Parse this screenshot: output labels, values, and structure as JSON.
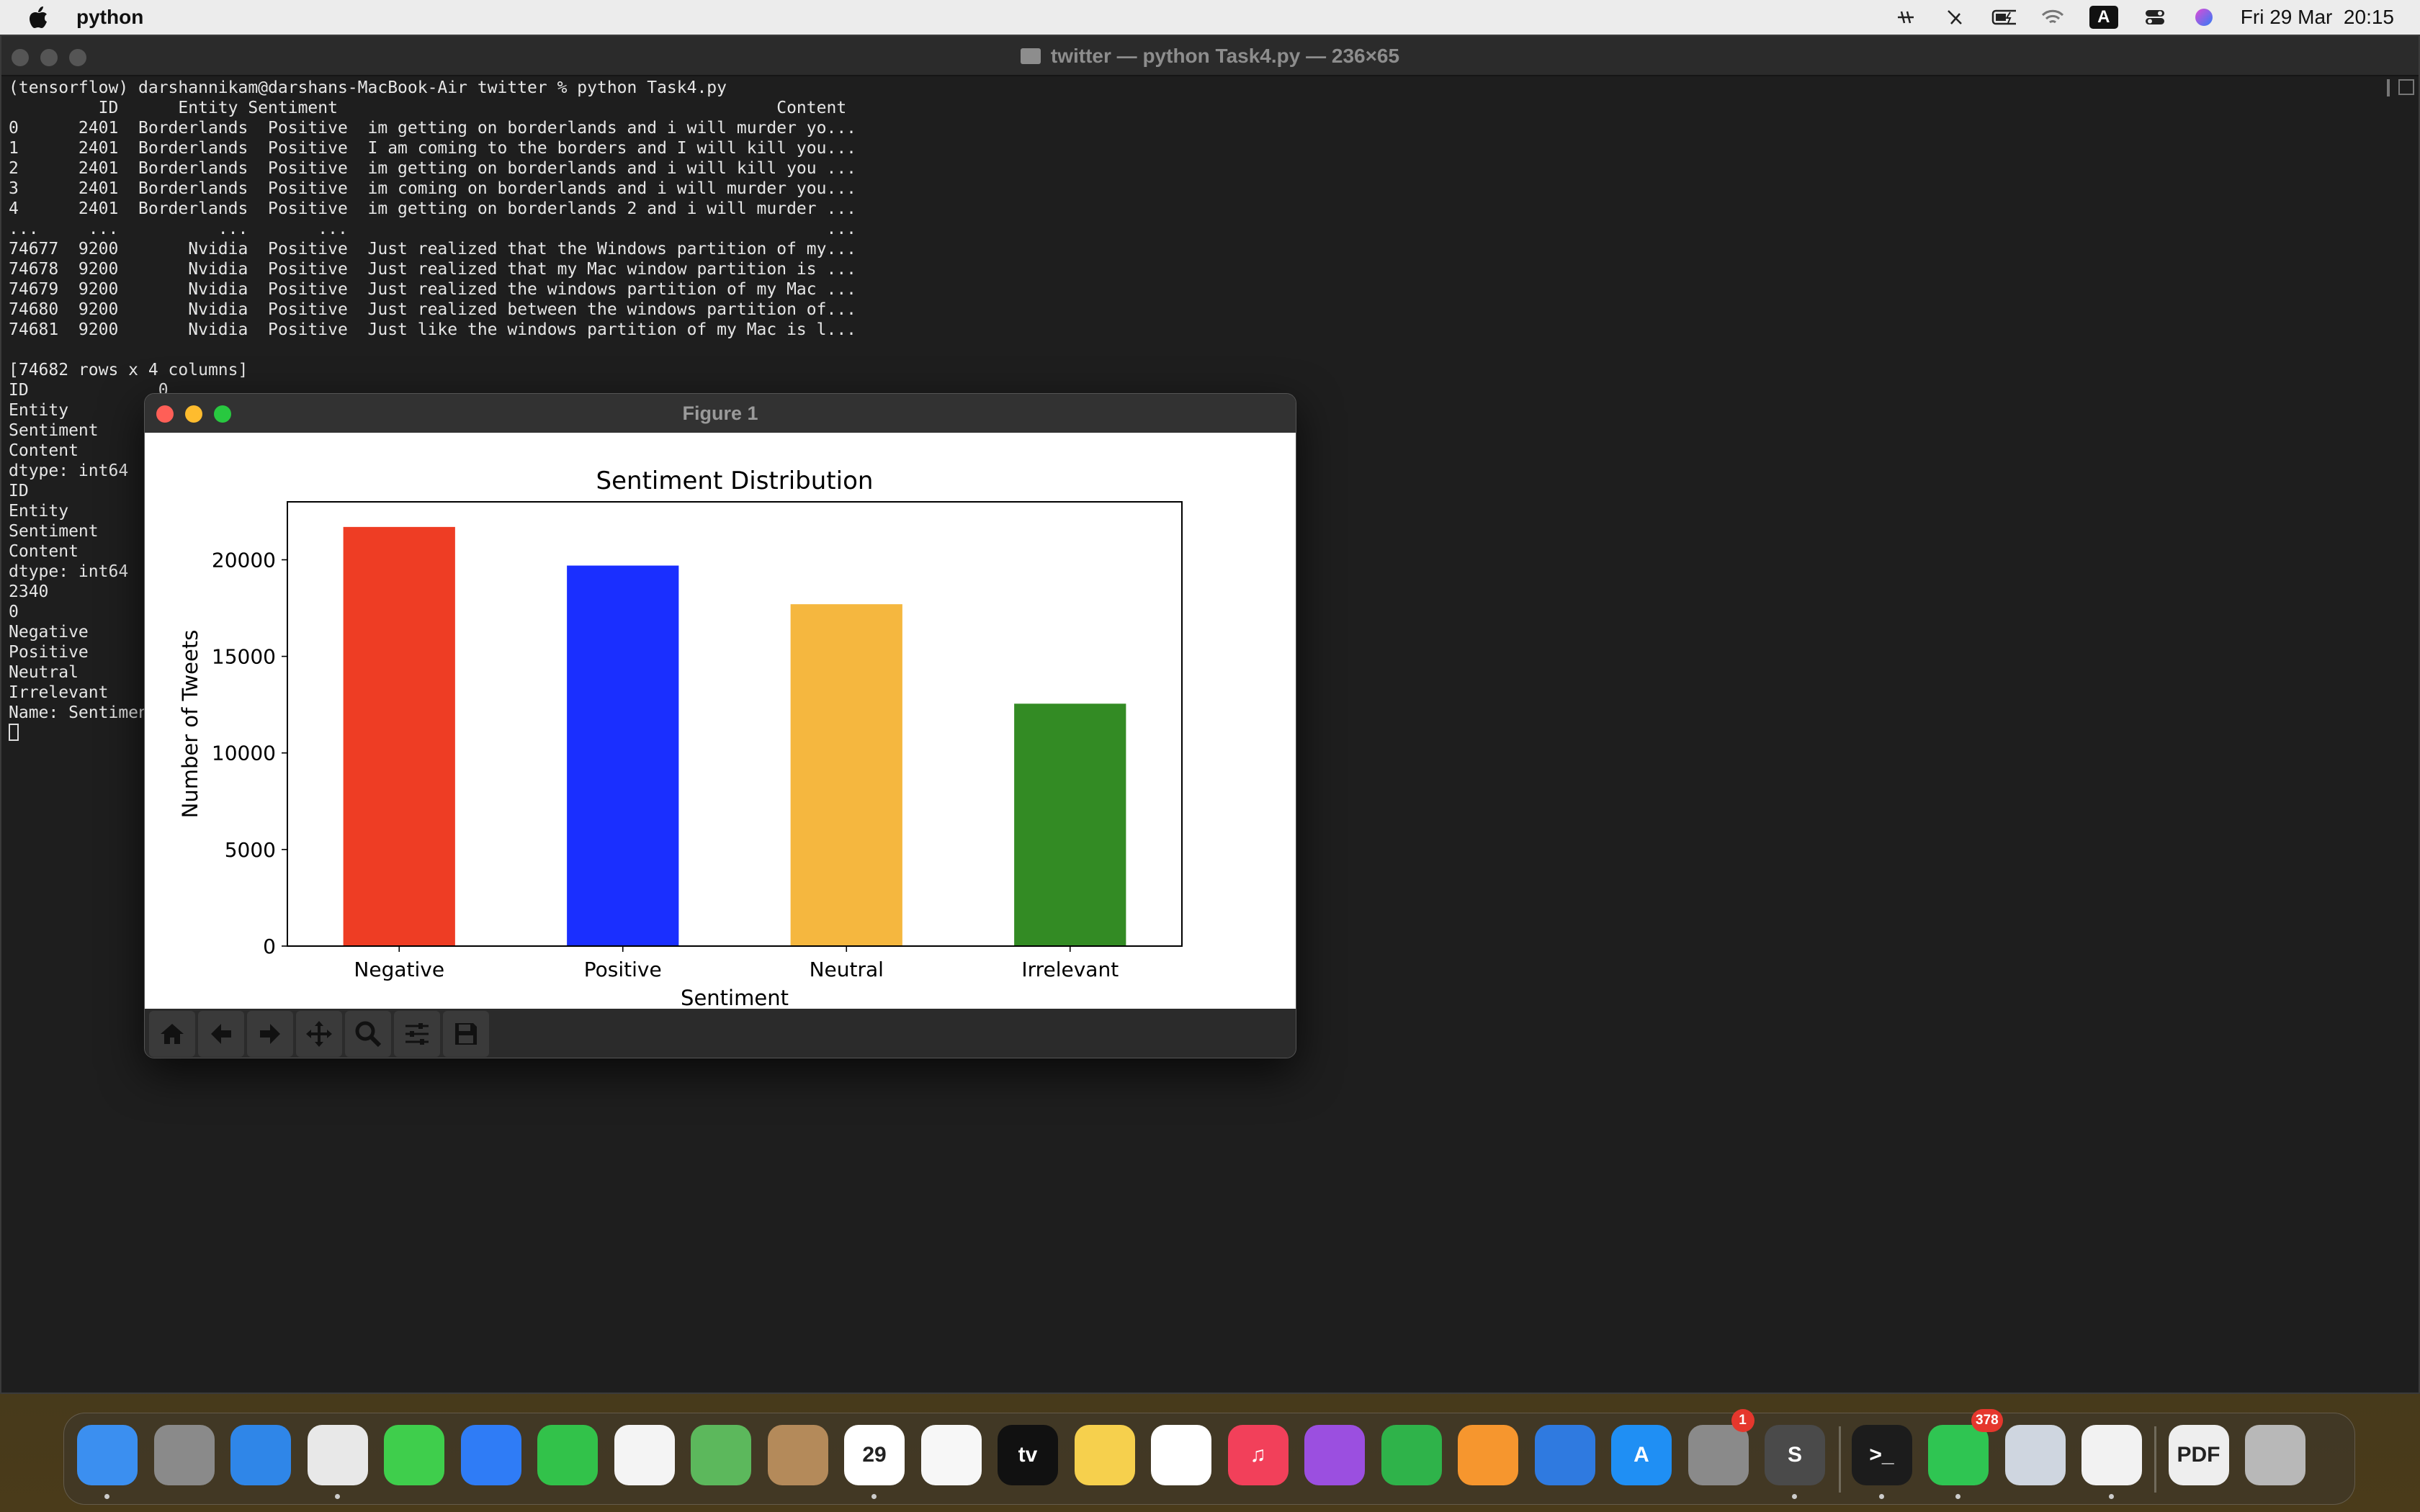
{
  "menubar": {
    "app_name": "python",
    "datetime": "Fri 29 Mar  20:15",
    "input_source": "A"
  },
  "terminal": {
    "title": "twitter — python Task4.py — 236×65",
    "lines": [
      "(tensorflow) darshannikam@darshans-MacBook-Air twitter % python Task4.py",
      "         ID      Entity Sentiment                                            Content",
      "0      2401  Borderlands  Positive  im getting on borderlands and i will murder yo...",
      "1      2401  Borderlands  Positive  I am coming to the borders and I will kill you...",
      "2      2401  Borderlands  Positive  im getting on borderlands and i will kill you ...",
      "3      2401  Borderlands  Positive  im coming on borderlands and i will murder you...",
      "4      2401  Borderlands  Positive  im getting on borderlands 2 and i will murder ...",
      "...     ...          ...       ...                                                ...",
      "74677  9200       Nvidia  Positive  Just realized that the Windows partition of my...",
      "74678  9200       Nvidia  Positive  Just realized that my Mac window partition is ...",
      "74679  9200       Nvidia  Positive  Just realized the windows partition of my Mac ...",
      "74680  9200       Nvidia  Positive  Just realized between the windows partition of...",
      "74681  9200       Nvidia  Positive  Just like the windows partition of my Mac is l...",
      "",
      "[74682 rows x 4 columns]",
      "ID             0",
      "Entity         0",
      "Sentiment      0",
      "Content        0",
      "dtype: int64",
      "ID             0",
      "Entity         0",
      "Sentiment      0",
      "Content        0",
      "dtype: int64",
      "2340",
      "0",
      "Negative",
      "Positive",
      "Neutral",
      "Irrelevant",
      "Name: Sentiment"
    ]
  },
  "figure": {
    "window_title": "Figure 1",
    "toolbar": [
      "home-icon",
      "back-arrow-icon",
      "forward-arrow-icon",
      "pan-icon",
      "zoom-icon",
      "configure-subplots-icon",
      "save-icon"
    ]
  },
  "chart_data": {
    "type": "bar",
    "title": "Sentiment Distribution",
    "xlabel": "Sentiment",
    "ylabel": "Number of Tweets",
    "categories": [
      "Negative",
      "Positive",
      "Neutral",
      "Irrelevant"
    ],
    "values": [
      21700,
      19700,
      17700,
      12550
    ],
    "colors": [
      "#ee3d24",
      "#1a2fff",
      "#f5b73f",
      "#338b24"
    ],
    "ylim": [
      0,
      23000
    ],
    "yticks": [
      0,
      5000,
      10000,
      15000,
      20000
    ],
    "grid": false
  },
  "dock": {
    "apps": [
      {
        "name": "Finder",
        "label": "",
        "color": "#3b8ff0"
      },
      {
        "name": "Launchpad",
        "label": "",
        "color": "#8a8a8a"
      },
      {
        "name": "Safari",
        "label": "",
        "color": "#2f86e8"
      },
      {
        "name": "Chrome",
        "label": "",
        "color": "#e8e8e8"
      },
      {
        "name": "Messages",
        "label": "",
        "color": "#3fce4c"
      },
      {
        "name": "Mail",
        "label": "",
        "color": "#2f7cf6"
      },
      {
        "name": "FaceTime",
        "label": "",
        "color": "#32c24a"
      },
      {
        "name": "Photos",
        "label": "",
        "color": "#f4f4f4"
      },
      {
        "name": "Maps",
        "label": "",
        "color": "#5cb85c"
      },
      {
        "name": "Contacts",
        "label": "",
        "color": "#b48a5a"
      },
      {
        "name": "Calendar",
        "label": "29",
        "color": "#ffffff"
      },
      {
        "name": "Reminders",
        "label": "",
        "color": "#f7f7f7"
      },
      {
        "name": "TV",
        "label": "tv",
        "color": "#111111"
      },
      {
        "name": "Notes",
        "label": "",
        "color": "#f6d04d"
      },
      {
        "name": "Freeform",
        "label": "",
        "color": "#ffffff"
      },
      {
        "name": "Music",
        "label": "♫",
        "color": "#f2405a"
      },
      {
        "name": "Podcasts",
        "label": "",
        "color": "#9b4fe0"
      },
      {
        "name": "Numbers",
        "label": "",
        "color": "#2fb34a"
      },
      {
        "name": "Pages",
        "label": "",
        "color": "#f6962e"
      },
      {
        "name": "Keynote",
        "label": "",
        "color": "#2f7ae0"
      },
      {
        "name": "App Store",
        "label": "A",
        "color": "#1f8ff4"
      },
      {
        "name": "System Settings",
        "label": "",
        "color": "#8a8a8a",
        "badge": "1"
      },
      {
        "name": "Sublime Text",
        "label": "S",
        "color": "#4a4a4a"
      },
      {
        "name": "Terminal",
        "label": ">_",
        "color": "#1c1c1c"
      },
      {
        "name": "WhatsApp",
        "label": "",
        "color": "#2fc552",
        "badge": "378"
      },
      {
        "name": "Preview",
        "label": "",
        "color": "#cfd6e0"
      },
      {
        "name": "Document",
        "label": "",
        "color": "#f2f2f2"
      },
      {
        "name": "PDF",
        "label": "PDF",
        "color": "#eeeeee"
      },
      {
        "name": "Trash",
        "label": "",
        "color": "#b8b8b8"
      }
    ]
  }
}
